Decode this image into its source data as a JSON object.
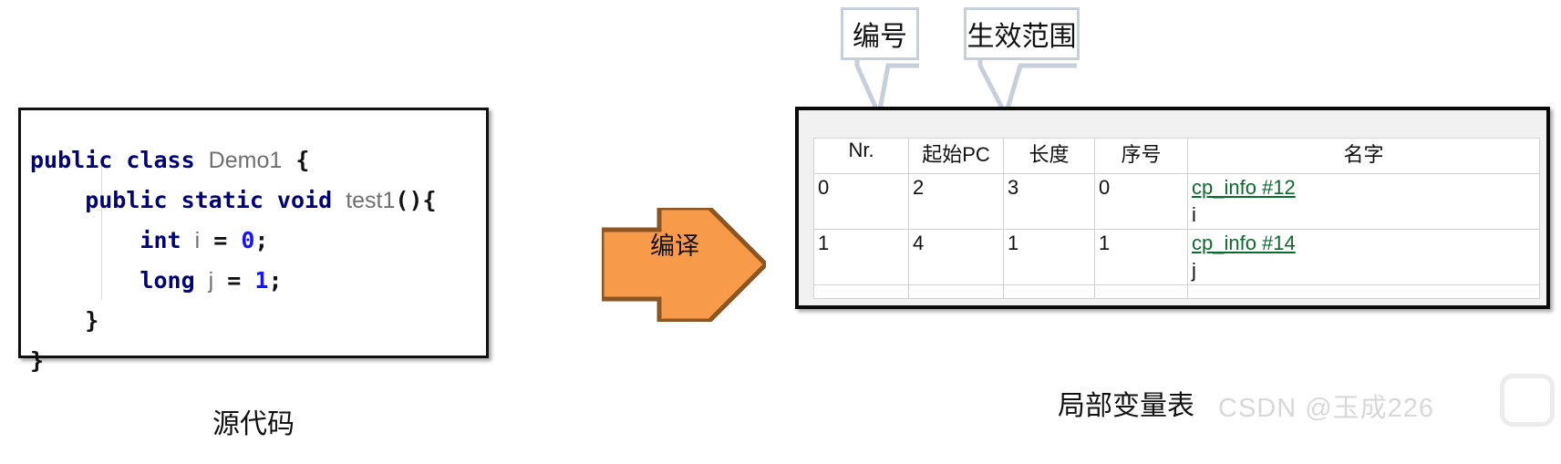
{
  "code_panel": {
    "caption": "源代码",
    "lines": [
      [
        {
          "t": "public class ",
          "k": "kw"
        },
        {
          "t": "Demo1",
          "k": "id"
        },
        {
          "t": " {",
          "k": "pun"
        }
      ],
      [
        {
          "t": "    public static void ",
          "k": "kw"
        },
        {
          "t": "test1",
          "k": "id"
        },
        {
          "t": "(){",
          "k": "pun"
        }
      ],
      [
        {
          "t": "        int ",
          "k": "kw"
        },
        {
          "t": "i",
          "k": "id"
        },
        {
          "t": " = ",
          "k": "pun"
        },
        {
          "t": "0",
          "k": "num"
        },
        {
          "t": ";",
          "k": "pun"
        }
      ],
      [
        {
          "t": "        long ",
          "k": "kw"
        },
        {
          "t": "j",
          "k": "id"
        },
        {
          "t": " = ",
          "k": "pun"
        },
        {
          "t": "1",
          "k": "num"
        },
        {
          "t": ";",
          "k": "pun"
        }
      ],
      [
        {
          "t": "    }",
          "k": "pun"
        }
      ],
      [
        {
          "t": "}",
          "k": "pun"
        }
      ]
    ]
  },
  "arrow": {
    "label": "编译",
    "fill": "#f79a4a",
    "stroke": "#8c5521"
  },
  "callouts": [
    {
      "label": "编号"
    },
    {
      "label": "生效范围"
    }
  ],
  "local_variable_table": {
    "caption": "局部变量表",
    "headers": [
      "Nr.",
      "起始PC",
      "长度",
      "序号",
      "名字"
    ],
    "rows": [
      {
        "nr": "0",
        "start_pc": "2",
        "length": "3",
        "index": "0",
        "name_link": "cp_info #12",
        "name_var": "i"
      },
      {
        "nr": "1",
        "start_pc": "4",
        "length": "1",
        "index": "1",
        "name_link": "cp_info #14",
        "name_var": "j"
      }
    ],
    "link_color": "#0b6b2e"
  },
  "watermark": {
    "text": "CSDN @玉成226"
  }
}
